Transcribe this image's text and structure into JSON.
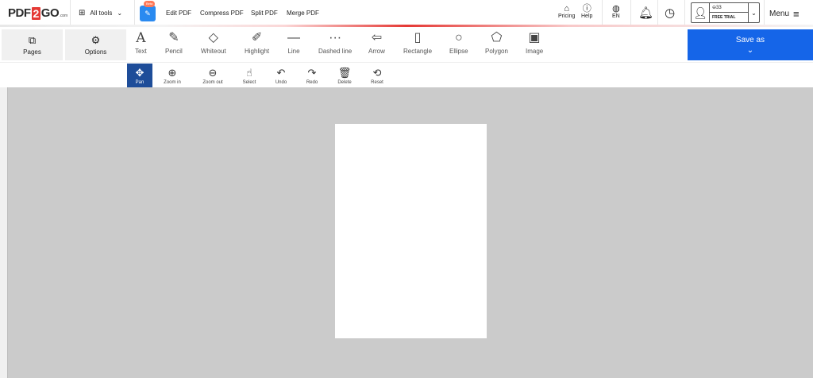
{
  "logo": {
    "prefix": "PDF",
    "number": "2",
    "suffix": "GO",
    "tld": ".com"
  },
  "header": {
    "all_tools": "All tools",
    "beta_badge": "Beta",
    "nav": [
      "Edit PDF",
      "Compress PDF",
      "Split PDF",
      "Merge PDF"
    ],
    "pricing": "Pricing",
    "help": "Help",
    "language": "EN",
    "account": {
      "credits": "33",
      "plan": "FREE TRIAL"
    },
    "menu": "Menu"
  },
  "toolbar": {
    "pages": "Pages",
    "options": "Options",
    "tools": [
      {
        "label": "Text",
        "icon": "text-icon"
      },
      {
        "label": "Pencil",
        "icon": "pencil-icon"
      },
      {
        "label": "Whiteout",
        "icon": "eraser-icon"
      },
      {
        "label": "Highlight",
        "icon": "highlighter-icon"
      },
      {
        "label": "Line",
        "icon": "line-icon"
      },
      {
        "label": "Dashed line",
        "icon": "dashed-line-icon"
      },
      {
        "label": "Arrow",
        "icon": "arrow-icon"
      },
      {
        "label": "Rectangle",
        "icon": "rectangle-icon"
      },
      {
        "label": "Ellipse",
        "icon": "ellipse-icon"
      },
      {
        "label": "Polygon",
        "icon": "polygon-icon"
      },
      {
        "label": "Image",
        "icon": "image-icon"
      }
    ],
    "save_as": "Save as"
  },
  "subtoolbar": [
    {
      "label": "Pan",
      "icon": "pan-icon",
      "active": true
    },
    {
      "label": "Zoom in",
      "icon": "zoom-in-icon"
    },
    {
      "label": "Zoom out",
      "icon": "zoom-out-icon"
    },
    {
      "label": "Select",
      "icon": "hand-pointer-icon"
    },
    {
      "label": "Undo",
      "icon": "undo-icon"
    },
    {
      "label": "Redo",
      "icon": "redo-icon"
    },
    {
      "label": "Delete",
      "icon": "trash-icon"
    },
    {
      "label": "Reset",
      "icon": "reset-icon"
    }
  ],
  "colors": {
    "brand_red": "#e53935",
    "save_blue": "#1565e8",
    "active_tool": "#1e4d99",
    "canvas_bg": "#cbcbcb"
  }
}
